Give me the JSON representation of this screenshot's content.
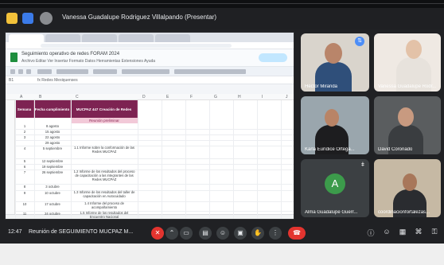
{
  "presenter_label": "Vanessa Guadalupe Rodriguez Villalpando (Presentar)",
  "doc": {
    "title": "Seguimiento operativo de redes FORAM 2024",
    "menu": "Archivo  Editar  Ver  Insertar  Formato  Datos  Herramientas  Extensiones  Ayuda",
    "cell_ref": "B1",
    "formula": "fx  Redes Mexiquenses",
    "columns": [
      "A",
      "B",
      "C",
      "D",
      "E",
      "F",
      "G",
      "H",
      "I",
      "J"
    ],
    "headers": [
      "Semana",
      "Fecha cumplimiento",
      "MUCPAZ 447 Creación de Redes"
    ],
    "first_task": "Reunión preliminar",
    "rows": [
      {
        "n": "1",
        "date": "8 agosto",
        "task": ""
      },
      {
        "n": "2",
        "date": "15 agosto",
        "task": ""
      },
      {
        "n": "3",
        "date": "22 agosto",
        "task": ""
      },
      {
        "n": "",
        "date": "29 agosto",
        "task": ""
      },
      {
        "n": "4",
        "date": "5 septiembre",
        "task": "1.1 Informe sobre la conformación de las Redes MUCPAZ"
      },
      {
        "n": "5",
        "date": "12 septiembre",
        "task": ""
      },
      {
        "n": "6",
        "date": "19 septiembre",
        "task": ""
      },
      {
        "n": "7",
        "date": "26 septiembre",
        "task": "1.2 Informe de los resultados del proceso de capacitación a las integrantes de las Redes MUCPAZ"
      },
      {
        "n": "8",
        "date": "3 octubre",
        "task": ""
      },
      {
        "n": "9",
        "date": "10 octubre",
        "task": "1.3 Informe de los resultados del taller de capacitación en Autocuidado"
      },
      {
        "n": "10",
        "date": "17 octubre",
        "task": "1.4 Informe del proceso de acompañamiento"
      },
      {
        "n": "11",
        "date": "24 octubre",
        "task": "1.5 Informe de los resultados del Encuentro Nacional"
      },
      {
        "n": "12",
        "date": "31 octubre",
        "task": "Producto Final"
      },
      {
        "n": "13",
        "date": "7 noviembre",
        "task": ""
      }
    ]
  },
  "participants": [
    {
      "name": "Héctor Miranda",
      "skin": "#b9856a",
      "shirt": "#2f4f7a",
      "bg": "#d9d4cc",
      "pinned": true
    },
    {
      "name": "Vanessa Guadalupe Rodr...",
      "skin": "#e3c2a8",
      "shirt": "#e7e2dc",
      "bg": "#efe9e3",
      "pinned": false
    },
    {
      "name": "Karla Eurídice Ortega...",
      "skin": "#b98466",
      "shirt": "#1d1d1f",
      "bg": "#9aa6ad",
      "pinned": false
    },
    {
      "name": "David Coronado",
      "skin": "#c89a80",
      "shirt": "#3a3d40",
      "bg": "#5a5d5f",
      "pinned": false
    },
    {
      "name": "Alma Guadalupe Guerr...",
      "initial": "A",
      "bg": "#3c4043"
    },
    {
      "name": "coordinacionfortalezas...",
      "skin": "#a8775a",
      "shirt": "#2a2c30",
      "bg": "#c6b9a4",
      "pinned": false
    }
  ],
  "bottom": {
    "time": "12:47",
    "meeting": "Reunión de SEGUIMIENTO MUCPAZ M...",
    "participant_count": "6"
  },
  "colors": {
    "header": "#7d2352",
    "pink": "#f2c9d8",
    "end_call": "#e3342f"
  }
}
